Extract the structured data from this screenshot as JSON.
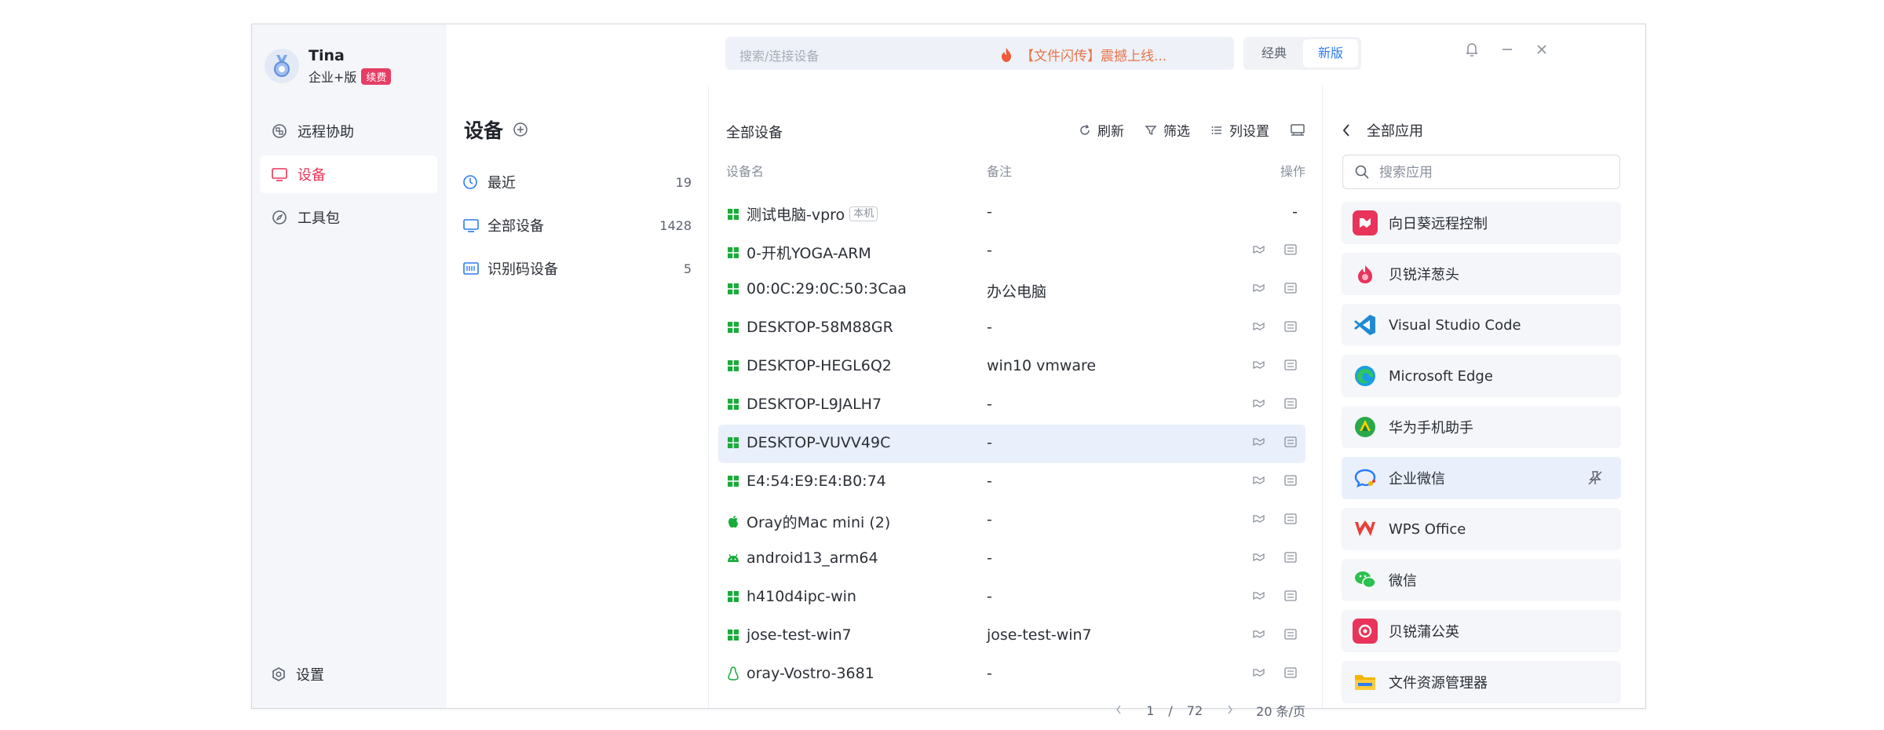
{
  "user": {
    "name": "Tina",
    "plan": "企业+版",
    "renew_label": "续费"
  },
  "nav": {
    "items": [
      {
        "label": "远程协助",
        "icon": "remote-assist-icon"
      },
      {
        "label": "设备",
        "icon": "monitor-icon"
      },
      {
        "label": "工具包",
        "icon": "compass-icon"
      }
    ],
    "settings_label": "设置"
  },
  "topbar": {
    "search_placeholder": "搜索/连接设备",
    "promo": "【文件闪传】震撼上线...",
    "modes": [
      "经典",
      "新版"
    ]
  },
  "devices": {
    "title": "设备",
    "categories": [
      {
        "label": "最近",
        "count": "19",
        "icon": "clock-icon"
      },
      {
        "label": "全部设备",
        "count": "1428",
        "icon": "monitor-icon"
      },
      {
        "label": "识别码设备",
        "count": "5",
        "icon": "id-code-icon"
      }
    ]
  },
  "table": {
    "title": "全部设备",
    "tools": {
      "refresh": "刷新",
      "filter": "筛选",
      "columns": "列设置"
    },
    "headers": {
      "name": "设备名",
      "remark": "备注",
      "ops": "操作"
    },
    "local_tag": "本机",
    "rows": [
      {
        "name": "测试电脑-vpro",
        "remark": "-",
        "os": "windows",
        "ops_text": "-"
      },
      {
        "name": "0-开机YOGA-ARM",
        "remark": "-",
        "os": "windows"
      },
      {
        "name": "00:0C:29:0C:50:3Caa",
        "remark": "办公电脑",
        "os": "windows"
      },
      {
        "name": "DESKTOP-58M88GR",
        "remark": "-",
        "os": "windows"
      },
      {
        "name": "DESKTOP-HEGL6Q2",
        "remark": "win10 vmware",
        "os": "windows"
      },
      {
        "name": "DESKTOP-L9JALH7",
        "remark": "-",
        "os": "windows"
      },
      {
        "name": "DESKTOP-VUVV49C",
        "remark": "-",
        "os": "windows"
      },
      {
        "name": "E4:54:E9:E4:B0:74",
        "remark": "-",
        "os": "windows"
      },
      {
        "name": "Oray的Mac mini (2)",
        "remark": "-",
        "os": "apple"
      },
      {
        "name": "android13_arm64",
        "remark": "-",
        "os": "android"
      },
      {
        "name": "h410d4ipc-win",
        "remark": "-",
        "os": "windows"
      },
      {
        "name": "jose-test-win7",
        "remark": "jose-test-win7",
        "os": "windows"
      },
      {
        "name": "oray-Vostro-3681",
        "remark": "-",
        "os": "linux"
      }
    ],
    "pager": {
      "current": "1",
      "sep": "/",
      "total": "72",
      "page_size": "20 条/页"
    }
  },
  "apps": {
    "title": "全部应用",
    "search_placeholder": "搜索应用",
    "items": [
      {
        "name": "向日葵远程控制",
        "icon": "sunlogin-icon",
        "color": "#e8345a"
      },
      {
        "name": "贝锐洋葱头",
        "icon": "onion-icon",
        "color": "#e8345a"
      },
      {
        "name": "Visual Studio Code",
        "icon": "vscode-icon",
        "color": "#1f8ad2"
      },
      {
        "name": "Microsoft Edge",
        "icon": "edge-icon",
        "color": "#1b9de2"
      },
      {
        "name": "华为手机助手",
        "icon": "huawei-assistant-icon",
        "color": "#2aa84a"
      },
      {
        "name": "企业微信",
        "icon": "wecom-icon",
        "color": "#2b7cf6"
      },
      {
        "name": "WPS Office",
        "icon": "wps-icon",
        "color": "#e8403a"
      },
      {
        "name": "微信",
        "icon": "wechat-icon",
        "color": "#2bc150"
      },
      {
        "name": "贝锐蒲公英",
        "icon": "pgy-icon",
        "color": "#e8345a"
      },
      {
        "name": "文件资源管理器",
        "icon": "folder-icon",
        "color": "#f4b400"
      }
    ]
  },
  "colors": {
    "accent": "#e8345a",
    "blue": "#2b7cf6",
    "windows_green": "#1aab3a"
  }
}
